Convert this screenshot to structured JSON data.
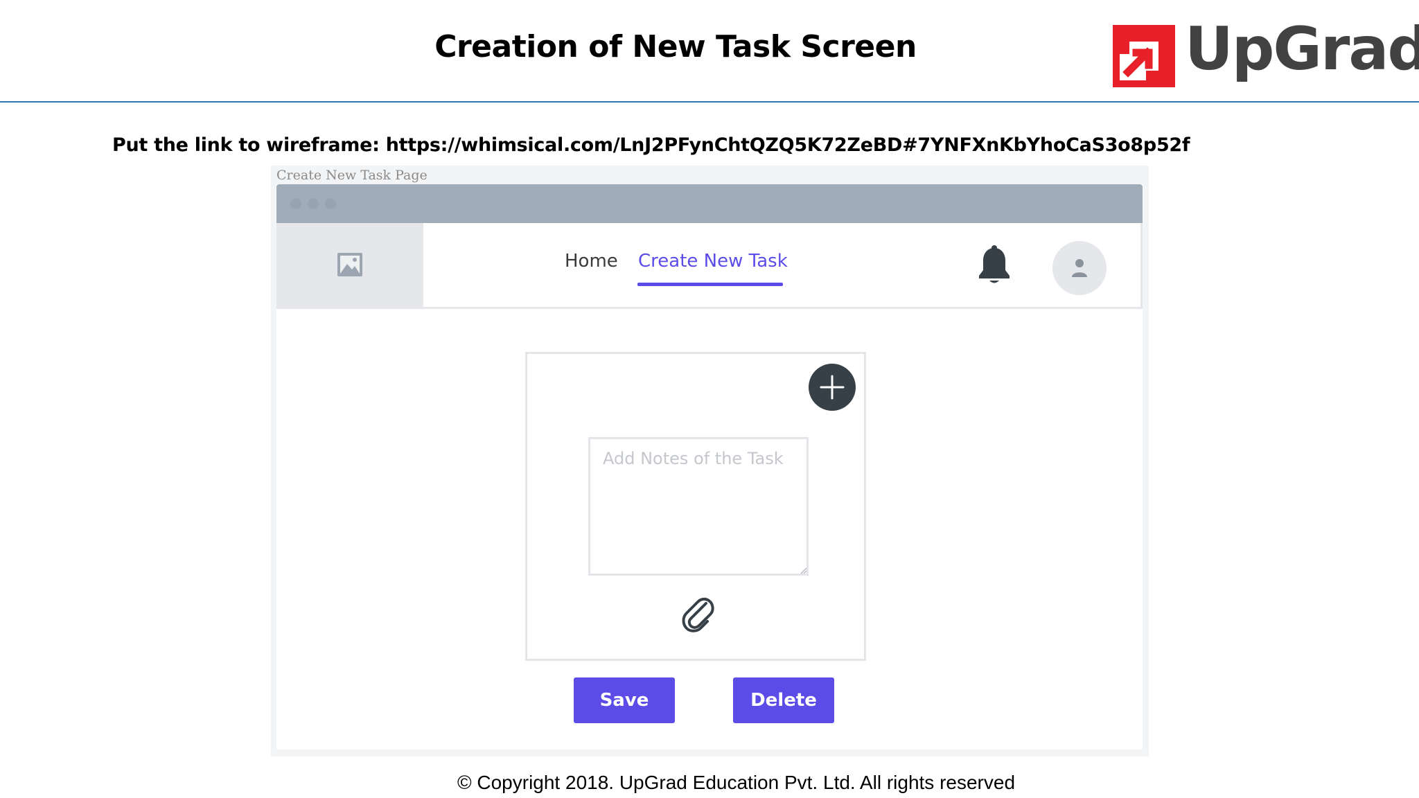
{
  "slide": {
    "title": "Creation of New Task Screen",
    "logo_text": "UpGrad",
    "link_line": "Put the link to wireframe: https://whimsical.com/LnJ2PFynChtQZQ5K72ZeBD#7YNFXnKbYhoCaS3o8p52f",
    "footer": "© Copyright 2018. UpGrad Education Pvt. Ltd. All rights reserved"
  },
  "wireframe": {
    "caption": "Create New Task Page",
    "nav": {
      "home_label": "Home",
      "create_label": "Create New Task",
      "active_tab": "Create New Task"
    },
    "icons": {
      "logo_placeholder": "image-icon",
      "notifications": "bell-icon",
      "profile": "user-icon",
      "add": "plus-icon",
      "attach": "paperclip-icon"
    },
    "task_form": {
      "notes_placeholder": "Add Notes of the Task",
      "notes_value": "",
      "save_label": "Save",
      "delete_label": "Delete"
    }
  },
  "colors": {
    "accent": "#5b4ce8",
    "browser_bar": "#a0acb8",
    "placeholder_gray": "#e5e7eb",
    "add_button": "#374047",
    "logo_red": "#e8202a",
    "header_rule": "#2e75b6"
  }
}
